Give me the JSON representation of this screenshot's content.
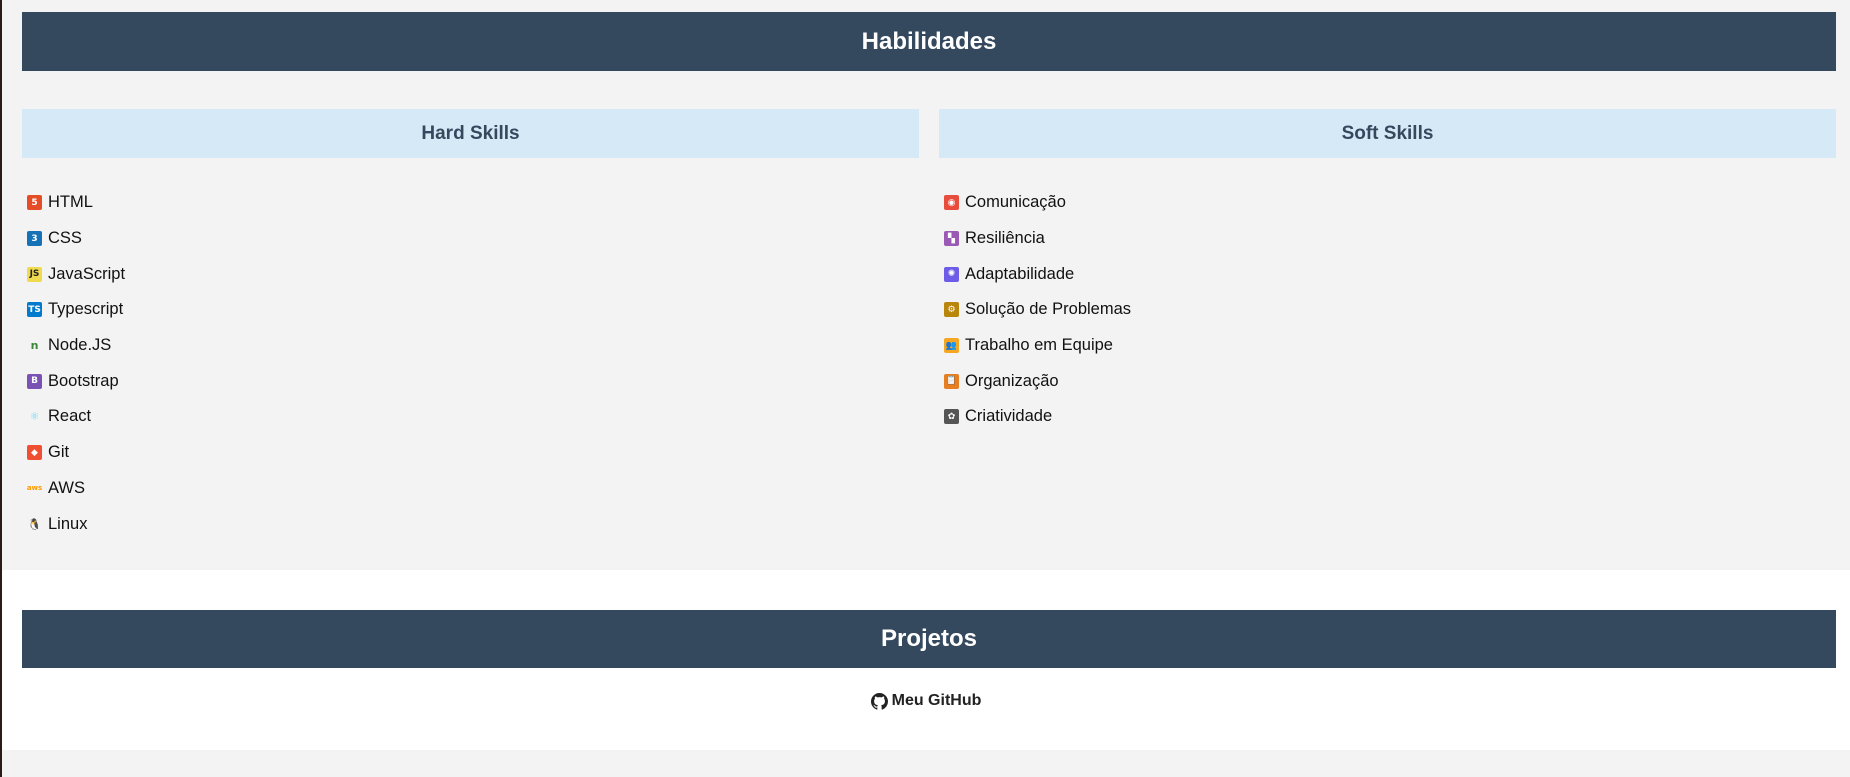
{
  "skills": {
    "title": "Habilidades",
    "hard": {
      "title": "Hard Skills",
      "items": [
        {
          "label": "HTML",
          "icon": "html5-icon",
          "color": "#e44d26",
          "glyph": "5"
        },
        {
          "label": "CSS",
          "icon": "css3-icon",
          "color": "#1572b6",
          "glyph": "3"
        },
        {
          "label": "JavaScript",
          "icon": "javascript-icon",
          "color": "#f0db4f",
          "glyph": "JS"
        },
        {
          "label": "Typescript",
          "icon": "typescript-icon",
          "color": "#007acc",
          "glyph": "TS"
        },
        {
          "label": "Node.JS",
          "icon": "nodejs-icon",
          "color": "#3c873a",
          "glyph": "n"
        },
        {
          "label": "Bootstrap",
          "icon": "bootstrap-icon",
          "color": "#7952b3",
          "glyph": "B"
        },
        {
          "label": "React",
          "icon": "react-icon",
          "color": "#61dafb",
          "glyph": "⚛"
        },
        {
          "label": "Git",
          "icon": "git-icon",
          "color": "#f05032",
          "glyph": "◆"
        },
        {
          "label": "AWS",
          "icon": "aws-icon",
          "color": "#ff9900",
          "glyph": "aws"
        },
        {
          "label": "Linux",
          "icon": "linux-tux-icon",
          "color": "#222222",
          "glyph": "🐧"
        }
      ]
    },
    "soft": {
      "title": "Soft Skills",
      "items": [
        {
          "label": "Comunicação",
          "icon": "communication-icon",
          "color": "#e74c3c",
          "glyph": "◉"
        },
        {
          "label": "Resiliência",
          "icon": "resilience-icon",
          "color": "#9b59b6",
          "glyph": "▚"
        },
        {
          "label": "Adaptabilidade",
          "icon": "adaptability-icon",
          "color": "#6c5ce7",
          "glyph": "✺"
        },
        {
          "label": "Solução de Problemas",
          "icon": "problem-solving-icon",
          "color": "#b8860b",
          "glyph": "⚙"
        },
        {
          "label": "Trabalho em Equipe",
          "icon": "teamwork-icon",
          "color": "#f5a623",
          "glyph": "👥"
        },
        {
          "label": "Organização",
          "icon": "organization-icon",
          "color": "#e67e22",
          "glyph": "📋"
        },
        {
          "label": "Criatividade",
          "icon": "creativity-icon",
          "color": "#555555",
          "glyph": "✿"
        }
      ]
    }
  },
  "projects": {
    "title": "Projetos",
    "github_label": "Meu GitHub",
    "github_icon": "github-icon"
  },
  "colors": {
    "header_bar": "#34495e",
    "column_header": "#d6e9f7",
    "page_background": "#f3f3f3"
  }
}
